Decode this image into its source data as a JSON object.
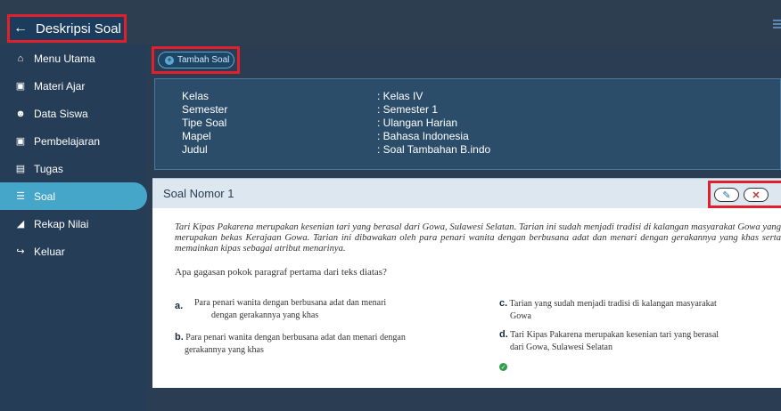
{
  "header": {
    "back_icon": "arrow-left-icon",
    "title": "Deskripsi Soal",
    "menu_icon": "hamburger-icon"
  },
  "sidebar": {
    "items": [
      {
        "label": "Menu Utama",
        "icon": "home-icon",
        "glyph": "⌂"
      },
      {
        "label": "Materi Ajar",
        "icon": "presentation-icon",
        "glyph": "▣"
      },
      {
        "label": "Data Siswa",
        "icon": "users-icon",
        "glyph": "☻"
      },
      {
        "label": "Pembelajaran",
        "icon": "presentation-icon",
        "glyph": "▣"
      },
      {
        "label": "Tugas",
        "icon": "tasks-icon",
        "glyph": "▤"
      },
      {
        "label": "Soal",
        "icon": "list-icon",
        "glyph": "☰",
        "active": true
      },
      {
        "label": "Rekap Nilai",
        "icon": "chart-icon",
        "glyph": "◢"
      },
      {
        "label": "Keluar",
        "icon": "logout-icon",
        "glyph": "↪"
      }
    ]
  },
  "toolbar": {
    "add_label": "Tambah Soal",
    "add_icon": "plus-circle-icon"
  },
  "info": {
    "rows": [
      {
        "key": "Kelas",
        "value": ": Kelas IV"
      },
      {
        "key": "Semester",
        "value": ": Semester 1"
      },
      {
        "key": "Tipe Soal",
        "value": ": Ulangan Harian"
      },
      {
        "key": "Mapel",
        "value": ": Bahasa Indonesia"
      },
      {
        "key": "Judul",
        "value": ": Soal Tambahan B.indo"
      }
    ]
  },
  "question": {
    "header": "Soal Nomor 1",
    "edit_icon": "pencil-icon",
    "delete_icon": "close-icon",
    "text": "Tari Kipas Pakarena merupakan kesenian tari yang berasal dari Gowa, Sulawesi Selatan. Tarian ini sudah menjadi tradisi di kalangan masyarakat Gowa yang merupakan bekas Kerajaan Gowa. Tarian ini dibawakan oleh para penari wanita dengan berbusana adat dan menari dengan gerakannya yang khas serta memainkan kipas sebagai atribut menarinya.",
    "prompt": "Apa gagasan pokok paragraf pertama dari teks diatas?",
    "options": {
      "a": {
        "letter": "a.",
        "line1": "Para penari wanita dengan berbusana adat dan menari",
        "line2": "dengan gerakannya yang khas"
      },
      "b": {
        "letter": "b.",
        "line1": "Para penari wanita dengan berbusana adat dan menari dengan",
        "line2": "gerakannya yang khas"
      },
      "c": {
        "letter": "c.",
        "line1": "Tarian yang sudah menjadi tradisi di kalangan masyarakat",
        "line2": "Gowa"
      },
      "d": {
        "letter": "d.",
        "line1": "Tari Kipas Pakarena merupakan kesenian tari yang berasal",
        "line2": "dari Gowa, Sulawesi Selatan"
      }
    },
    "correct_icon": "check-circle-icon",
    "correct_answer": "d"
  }
}
